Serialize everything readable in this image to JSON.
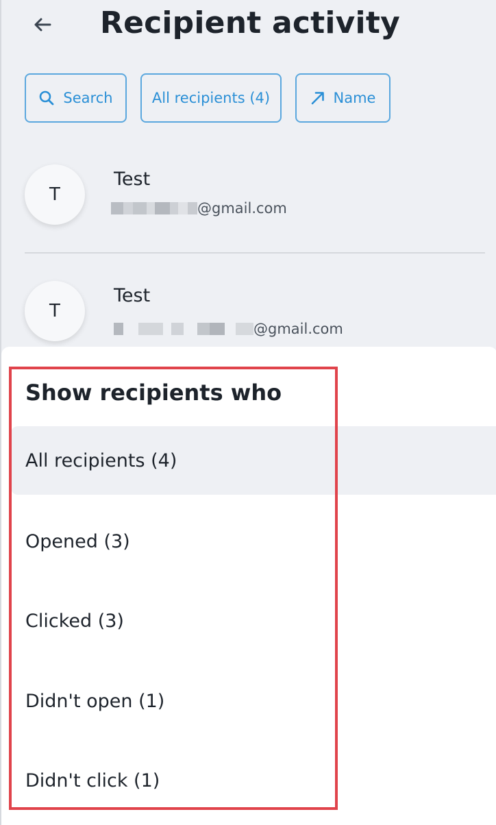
{
  "header": {
    "title": "Recipient activity",
    "back_icon": "arrow-left-icon"
  },
  "toolbar": {
    "search_label": "Search",
    "filter_label": "All recipients (4)",
    "sort_label": "Name",
    "search_icon": "search-icon",
    "sort_icon": "arrow-up-right-icon"
  },
  "recipients": [
    {
      "initial": "T",
      "name": "Test",
      "email_domain": "@gmail.com"
    },
    {
      "initial": "T",
      "name": "Test",
      "email_domain": "@gmail.com"
    }
  ],
  "filter_sheet": {
    "title": "Show recipients who",
    "options": [
      {
        "label": "All recipients (4)",
        "selected": true
      },
      {
        "label": "Opened (3)",
        "selected": false
      },
      {
        "label": "Clicked (3)",
        "selected": false
      },
      {
        "label": "Didn't open (1)",
        "selected": false
      },
      {
        "label": "Didn't click (1)",
        "selected": false
      }
    ]
  },
  "colors": {
    "accent": "#2a8fd6",
    "highlight": "#e0434b",
    "background": "#eef0f4"
  }
}
